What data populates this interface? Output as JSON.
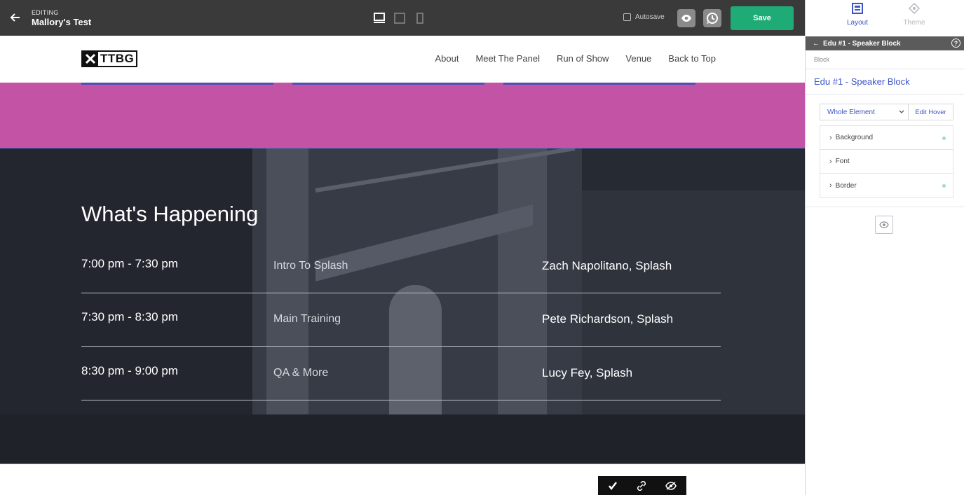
{
  "editor": {
    "editing_label": "EDITING",
    "page_name": "Mallory's Test",
    "autosave_label": "Autosave",
    "save_label": "Save"
  },
  "site": {
    "logo_text": "TTBG",
    "nav": [
      "About",
      "Meet The Panel",
      "Run of Show",
      "Venue",
      "Back to Top"
    ]
  },
  "schedule": {
    "title": "What's Happening",
    "rows": [
      {
        "time": "7:00 pm - 7:30 pm",
        "topic": "Intro To Splash",
        "speaker": "Zach Napolitano, Splash"
      },
      {
        "time": "7:30 pm - 8:30 pm",
        "topic": "Main Training",
        "speaker": "Pete Richardson, Splash"
      },
      {
        "time": "8:30 pm - 9:00 pm",
        "topic": "QA & More",
        "speaker": "Lucy Fey, Splash"
      }
    ]
  },
  "panel": {
    "tabs": [
      {
        "label": "Layout",
        "icon": "layout-icon",
        "active": true
      },
      {
        "label": "Theme",
        "icon": "theme-icon",
        "active": false
      }
    ],
    "header": "Edu #1 - Speaker Block",
    "help": "?",
    "crumb": "Block",
    "title": "Edu #1 - Speaker Block",
    "element_select": "Whole Element",
    "edit_hover": "Edit Hover",
    "properties": [
      {
        "label": "Background",
        "set": true
      },
      {
        "label": "Font",
        "set": false
      },
      {
        "label": "Border",
        "set": true
      }
    ]
  },
  "colors": {
    "save": "#1fab76",
    "accent": "#3d55c9",
    "pink": "#c353a4",
    "selection": "#6a72e8"
  }
}
